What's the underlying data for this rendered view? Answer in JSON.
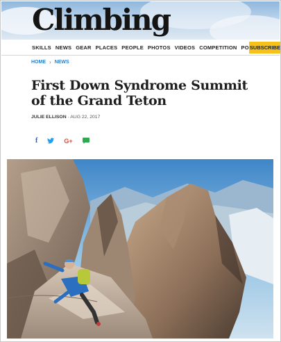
{
  "site": {
    "logo": "Climbing"
  },
  "nav": {
    "items": [
      "SKILLS",
      "NEWS",
      "GEAR",
      "PLACES",
      "PEOPLE",
      "PHOTOS",
      "VIDEOS",
      "COMPETITION",
      "PODCAST"
    ],
    "subscribe": "SUBSCRIBE"
  },
  "breadcrumb": {
    "home": "HOME",
    "separator": "›",
    "current": "NEWS"
  },
  "article": {
    "title": "First Down Syndrome Summit of the Grand Teton",
    "author": "JULIE ELLISON",
    "date": "· AUG 22, 2017"
  },
  "social": {
    "facebook": "f",
    "twitter": "twitter-bird-icon",
    "google": "G+",
    "message": "message-icon"
  },
  "colors": {
    "link": "#2f7fc6",
    "subscribe_bg": "#f6c118",
    "facebook": "#3b5998",
    "twitter": "#1da1f2",
    "google": "#dd4b39",
    "message": "#2fa84f"
  }
}
